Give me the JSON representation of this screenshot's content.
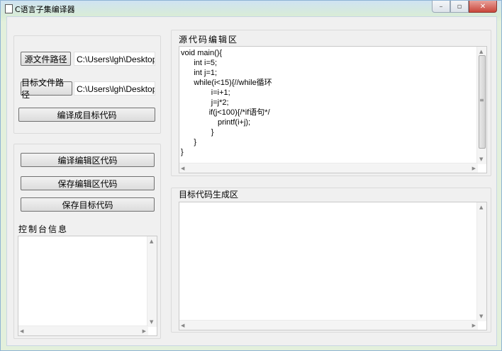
{
  "window": {
    "title": "C语言子集编译器",
    "min_glyph": "–",
    "max_glyph": "▫",
    "close_glyph": "✕"
  },
  "left_panel": {
    "source_path_button": "源文件路径",
    "source_path_value": "C:\\Users\\lgh\\Desktop",
    "target_path_button": "目标文件路径",
    "target_path_value": "C:\\Users\\lgh\\Desktop",
    "compile_to_target_button": "编译成目标代码",
    "compile_editor_button": "编译编辑区代码",
    "save_editor_button": "保存编辑区代码",
    "save_target_button": "保存目标代码",
    "console_label": "控制台信息",
    "console_text": ""
  },
  "editor": {
    "label": "源代码编辑区",
    "code": "void main(){\n      int i=5;\n      int j=1;\n      while(i<15){//while循环\n              i=i+1;\n              j=j*2;\n             if(j<100){/*if语句*/\n                 printf(i+j);\n              }\n      }\n}"
  },
  "output": {
    "label": "目标代码生成区",
    "text": ""
  },
  "scroll_glyphs": {
    "up": "▲",
    "down": "▼",
    "left": "◀",
    "right": "▶",
    "grip": "≡"
  }
}
